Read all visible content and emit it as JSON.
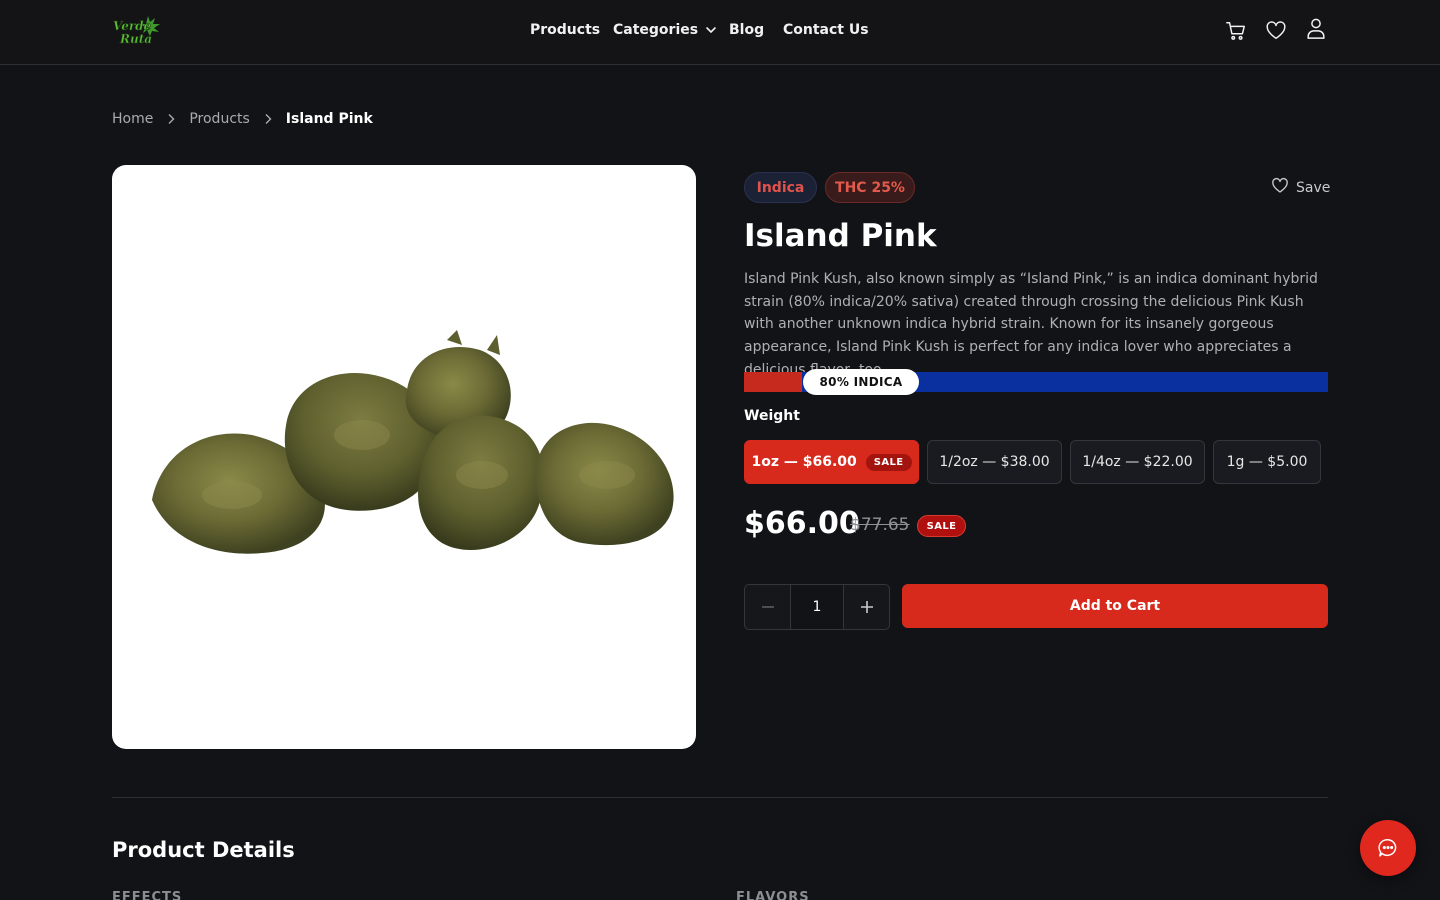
{
  "header": {
    "logo_text": "Verde Ruta",
    "nav": [
      {
        "label": "Products"
      },
      {
        "label": "Categories"
      },
      {
        "label": "Blog"
      },
      {
        "label": "Contact Us"
      }
    ],
    "icons": [
      "cart-icon",
      "heart-icon",
      "user-icon"
    ]
  },
  "breadcrumb": [
    "Home",
    "Products",
    "Island Pink"
  ],
  "product": {
    "tags": [
      "Indica",
      "THC 25%"
    ],
    "save_label": "Save",
    "title": "Island Pink",
    "description": "Island Pink Kush, also known simply as “Island Pink,” is an indica dominant hybrid strain (80% indica/20% sativa) created through crossing the delicious Pink Kush with another unknown indica hybrid strain. Known for its insanely gorgeous appearance, Island Pink Kush is perfect for any indica lover who appreciates a delicious flavor, too.",
    "ratio": {
      "label": "80% INDICA",
      "indica_fraction": 0.1,
      "indica_color": "#c62a1f",
      "sativa_color": "#0a2f9e"
    },
    "weight_label": "Weight",
    "weights": [
      {
        "label": "1oz — $66.00",
        "badge": "SALE",
        "selected": true
      },
      {
        "label": "1/2oz — $38.00",
        "badge": "",
        "selected": false
      },
      {
        "label": "1/4oz — $22.00",
        "badge": "",
        "selected": false
      },
      {
        "label": "1g — $5.00",
        "badge": "",
        "selected": false
      }
    ],
    "price": "$66.00",
    "price_old": "$77.65",
    "price_badge": "SALE",
    "quantity": "1",
    "add_to_cart": "Add to Cart"
  },
  "details": {
    "title": "Product Details",
    "effects_label": "EFFECTS",
    "flavors_label": "FLAVORS"
  },
  "colors": {
    "accent": "#d8291d",
    "background": "#121317"
  }
}
